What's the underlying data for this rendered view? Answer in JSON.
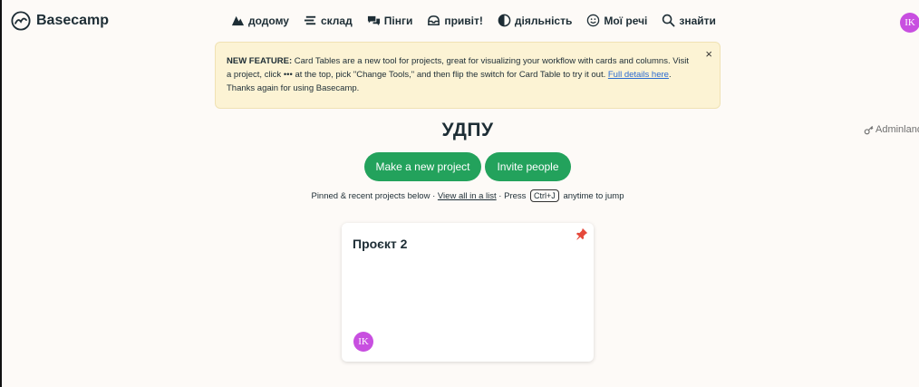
{
  "app": {
    "name": "Basecamp"
  },
  "nav": {
    "items": [
      {
        "label": "додому",
        "icon": "home-icon"
      },
      {
        "label": "склад",
        "icon": "lineup-icon"
      },
      {
        "label": "Пінги",
        "icon": "pings-icon"
      },
      {
        "label": "привіт!",
        "icon": "hey-icon"
      },
      {
        "label": "діяльність",
        "icon": "activity-icon"
      },
      {
        "label": "Мої речі",
        "icon": "smiley-icon"
      },
      {
        "label": "знайти",
        "icon": "search-icon"
      }
    ]
  },
  "user": {
    "initials": "IK",
    "color": "#c84fe0"
  },
  "banner": {
    "heading": "NEW FEATURE:",
    "text": " Card Tables are a new tool for projects, great for visualizing your workflow with cards and columns. Visit a project, click ••• at the top, pick \"Change Tools,\" and then flip the switch for Card Table to try it out. ",
    "link": "Full details here",
    "tail": ". Thanks again for using Basecamp.",
    "close": "×"
  },
  "adminland": {
    "label": "Adminland"
  },
  "page": {
    "title": "УДПУ"
  },
  "actions": {
    "new_project": "Make a new project",
    "invite": "Invite people"
  },
  "hint": {
    "prefix": "Pinned & recent projects below · ",
    "link": "View all in a list",
    "middle": " · Press ",
    "key": "Ctrl+J",
    "suffix": " anytime to jump"
  },
  "project_card": {
    "title": "Проєкт 2",
    "pinned": true,
    "member_initials": "IK"
  },
  "colors": {
    "accent_green": "#23a25c",
    "banner_bg": "#fcf3d4",
    "pin_red": "#e5483a"
  }
}
